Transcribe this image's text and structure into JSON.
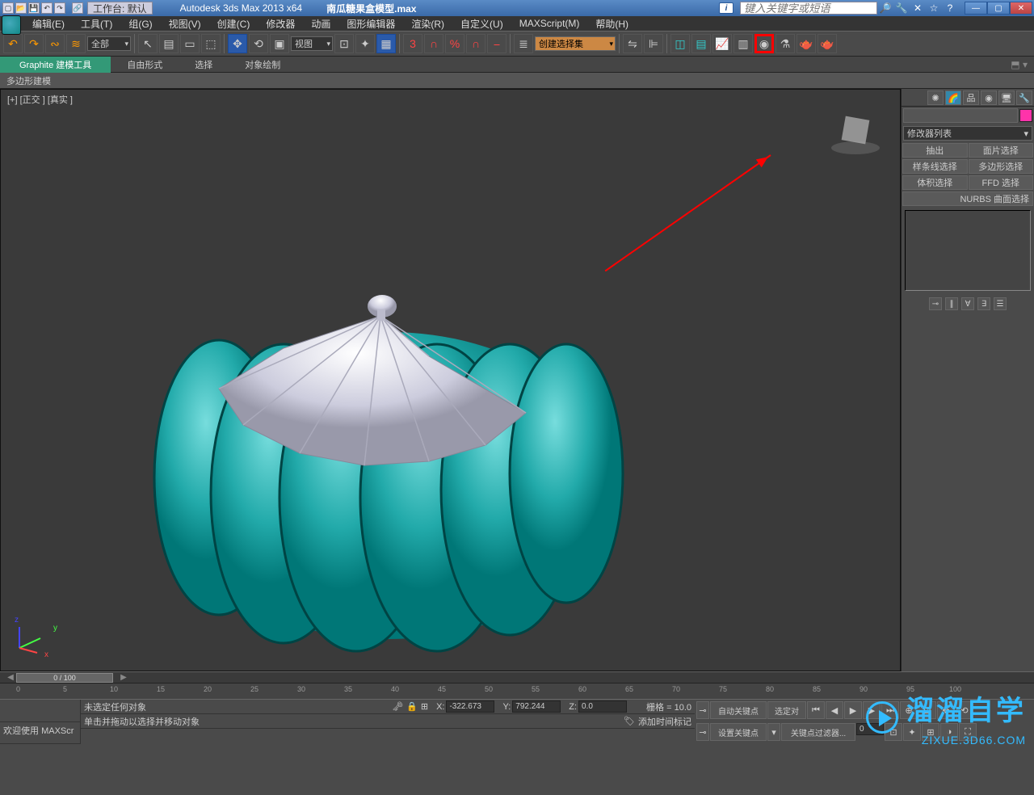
{
  "titlebar": {
    "workspace_label": "工作台: 默认",
    "app_title": "Autodesk 3ds Max  2013 x64",
    "file_name": "南瓜糖果盒模型.max",
    "search_placeholder": "键入关键字或短语"
  },
  "menu": {
    "items": [
      "编辑(E)",
      "工具(T)",
      "组(G)",
      "视图(V)",
      "创建(C)",
      "修改器",
      "动画",
      "图形编辑器",
      "渲染(R)",
      "自定义(U)",
      "MAXScript(M)",
      "帮助(H)"
    ]
  },
  "toolbar": {
    "filter_dd": "全部",
    "view_dd": "视图",
    "selset_dd": "创建选择集"
  },
  "ribbon": {
    "tab": "Graphite 建模工具",
    "btns": [
      "自由形式",
      "选择",
      "对象绘制"
    ],
    "panel": "多边形建模"
  },
  "viewport": {
    "label": "[+] [正交 ] [真实 ]",
    "gizmo_axes": {
      "x": "x",
      "y": "y",
      "z": "z"
    }
  },
  "cmdpanel": {
    "modifier_list": "修改器列表",
    "buttons": [
      [
        "抽出",
        "面片选择"
      ],
      [
        "样条线选择",
        "多边形选择"
      ],
      [
        "体积选择",
        "FFD 选择"
      ]
    ],
    "nurbs_btn": "NURBS 曲面选择"
  },
  "timeline": {
    "slider": "0 / 100",
    "ticks": [
      "0",
      "5",
      "10",
      "15",
      "20",
      "25",
      "30",
      "35",
      "40",
      "45",
      "50",
      "55",
      "60",
      "65",
      "70",
      "75",
      "80",
      "85",
      "90",
      "95",
      "100"
    ]
  },
  "status": {
    "welcome": "欢迎使用",
    "maxscript": "MAXScr",
    "sel_none": "未选定任何对象",
    "hint": "单击并拖动以选择并移动对象",
    "coord": {
      "xl": "X:",
      "x": "-322.673",
      "yl": "Y:",
      "y": "792.244",
      "zl": "Z:",
      "z": "0.0"
    },
    "grid": "栅格 = 10.0",
    "addtime": "添加时间标记",
    "autokey": "自动关键点",
    "selobj": "选定对",
    "setkey": "设置关键点",
    "keyfilter": "关键点过滤器..."
  },
  "watermark": {
    "big": "溜溜自学",
    "small": "ZIXUE.3D66.COM"
  }
}
